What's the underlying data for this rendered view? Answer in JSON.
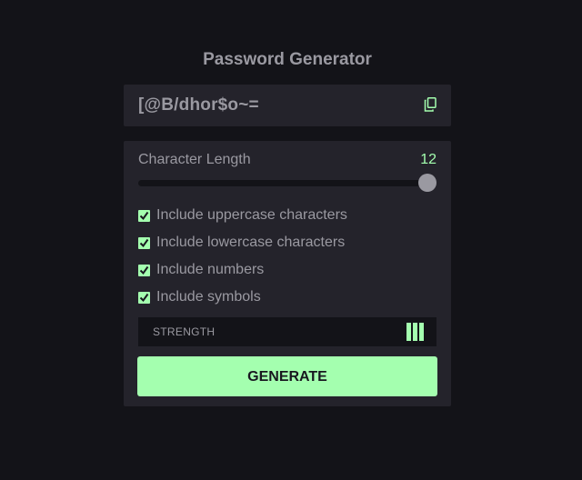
{
  "app": {
    "title": "Password Generator"
  },
  "output": {
    "password": "[@B/dhor$o~=",
    "copy_icon": "copy-icon"
  },
  "length": {
    "label": "Character Length",
    "value": "12",
    "slider_fraction": 1.0
  },
  "options": [
    {
      "label": "Include uppercase characters",
      "checked": true
    },
    {
      "label": "Include lowercase characters",
      "checked": true
    },
    {
      "label": "Include numbers",
      "checked": true
    },
    {
      "label": "Include symbols",
      "checked": true
    }
  ],
  "strength": {
    "label": "STRENGTH",
    "bars_filled": 3
  },
  "generate": {
    "label": "GENERATE"
  },
  "colors": {
    "background": "#131318",
    "panel": "#24232b",
    "accent": "#a4ffaf",
    "text": "#9a99a1",
    "button_text": "#18171f"
  }
}
